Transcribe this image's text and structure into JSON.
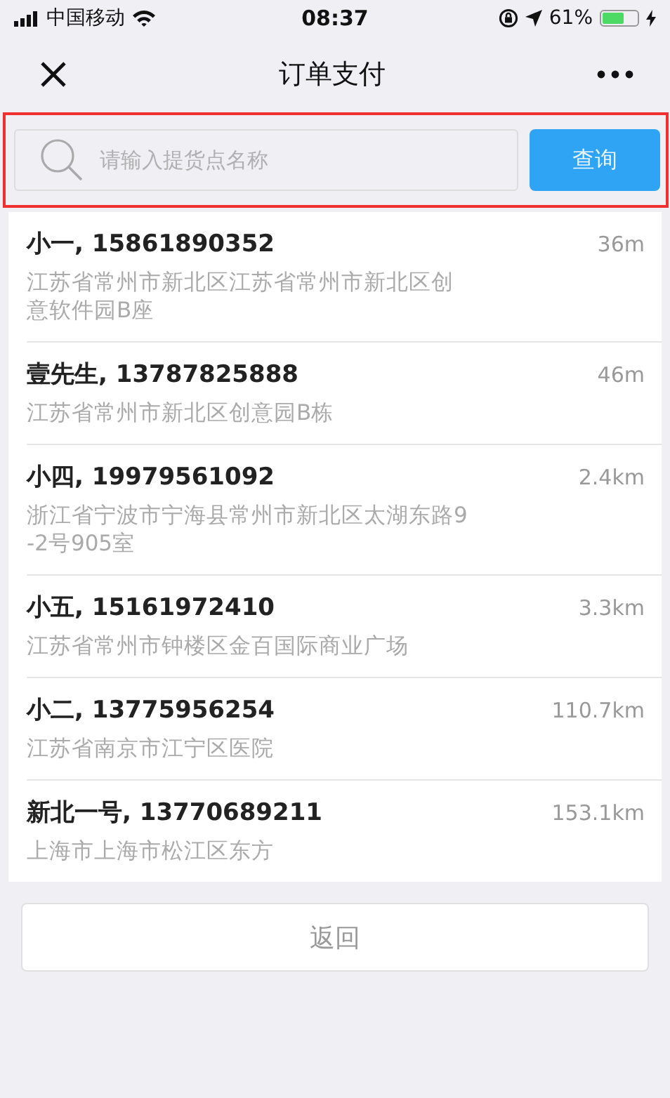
{
  "status_bar": {
    "carrier": "中国移动",
    "time": "08:37",
    "battery_text": "61%"
  },
  "nav": {
    "title": "订单支付"
  },
  "search": {
    "placeholder": "请输入提货点名称",
    "button": "查询"
  },
  "locations": [
    {
      "name": "小一, 15861890352",
      "distance": "36m",
      "address": "江苏省常州市新北区江苏省常州市新北区创意软件园B座"
    },
    {
      "name": "壹先生, 13787825888",
      "distance": "46m",
      "address": "江苏省常州市新北区创意园B栋"
    },
    {
      "name": "小四, 19979561092",
      "distance": "2.4km",
      "address": "浙江省宁波市宁海县常州市新北区太湖东路9-2号905室"
    },
    {
      "name": "小五, 15161972410",
      "distance": "3.3km",
      "address": "江苏省常州市钟楼区金百国际商业广场"
    },
    {
      "name": "小二, 13775956254",
      "distance": "110.7km",
      "address": "江苏省南京市江宁区医院"
    },
    {
      "name": "新北一号, 13770689211",
      "distance": "153.1km",
      "address": "上海市上海市松江区东方"
    }
  ],
  "back_button": "返回"
}
